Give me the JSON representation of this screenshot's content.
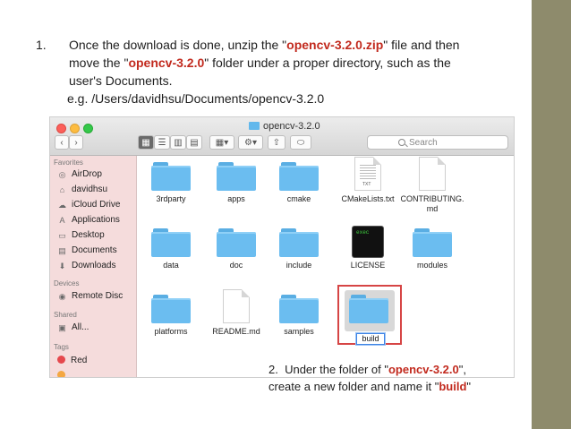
{
  "step1": {
    "number": "1.",
    "line1_a": "Once the download is done, unzip the \"",
    "line1_hl": "opencv-3.2.0.zip",
    "line1_b": "\" file and then",
    "line2_a": "move the \"",
    "line2_hl": "opencv-3.2.0",
    "line2_b": "\" folder under a proper directory, such as the",
    "line3": "user's Documents.",
    "example": "e.g.  /Users/davidhsu/Documents/opencv-3.2.0"
  },
  "finder": {
    "window_title": "opencv-3.2.0",
    "search_placeholder": "Search",
    "sidebar": {
      "favorites_header": "Favorites",
      "favorites": [
        {
          "label": "AirDrop",
          "icon": "airdrop-icon"
        },
        {
          "label": "davidhsu",
          "icon": "home-icon"
        },
        {
          "label": "iCloud Drive",
          "icon": "cloud-icon"
        },
        {
          "label": "Applications",
          "icon": "applications-icon"
        },
        {
          "label": "Desktop",
          "icon": "desktop-icon"
        },
        {
          "label": "Documents",
          "icon": "documents-icon"
        },
        {
          "label": "Downloads",
          "icon": "downloads-icon"
        }
      ],
      "devices_header": "Devices",
      "devices": [
        {
          "label": "Remote Disc",
          "icon": "disc-icon"
        }
      ],
      "shared_header": "Shared",
      "shared": [
        {
          "label": "All...",
          "icon": "network-icon"
        }
      ],
      "tags_header": "Tags",
      "tags": [
        {
          "label": "Red",
          "color": "#e5484d"
        }
      ]
    },
    "files": [
      {
        "name": "3rdparty",
        "kind": "folder"
      },
      {
        "name": "apps",
        "kind": "folder"
      },
      {
        "name": "cmake",
        "kind": "folder"
      },
      {
        "name": "CMakeLists.txt",
        "kind": "text",
        "badge": "TXT"
      },
      {
        "name": "CONTRIBUTING.\nmd",
        "kind": "doc"
      },
      {
        "name": "data",
        "kind": "folder"
      },
      {
        "name": "doc",
        "kind": "folder"
      },
      {
        "name": "include",
        "kind": "folder"
      },
      {
        "name": "LICENSE",
        "kind": "exec",
        "badge": "exec"
      },
      {
        "name": "modules",
        "kind": "folder"
      },
      {
        "name": "platforms",
        "kind": "folder"
      },
      {
        "name": "README.md",
        "kind": "doc"
      },
      {
        "name": "samples",
        "kind": "folder"
      }
    ],
    "new_folder_name": "build"
  },
  "step2": {
    "number": "2.",
    "line1_a": "Under the folder of \"",
    "line1_hl": "opencv-3.2.0",
    "line1_b": "\",",
    "line2_a": "create a new folder and name it \"",
    "line2_hl": "build",
    "line2_b": "\""
  },
  "colors": {
    "highlight": "#c22a1e",
    "accent_bar": "#8e8b6c",
    "folder": "#6bbdf0",
    "selection": "#d64545"
  }
}
